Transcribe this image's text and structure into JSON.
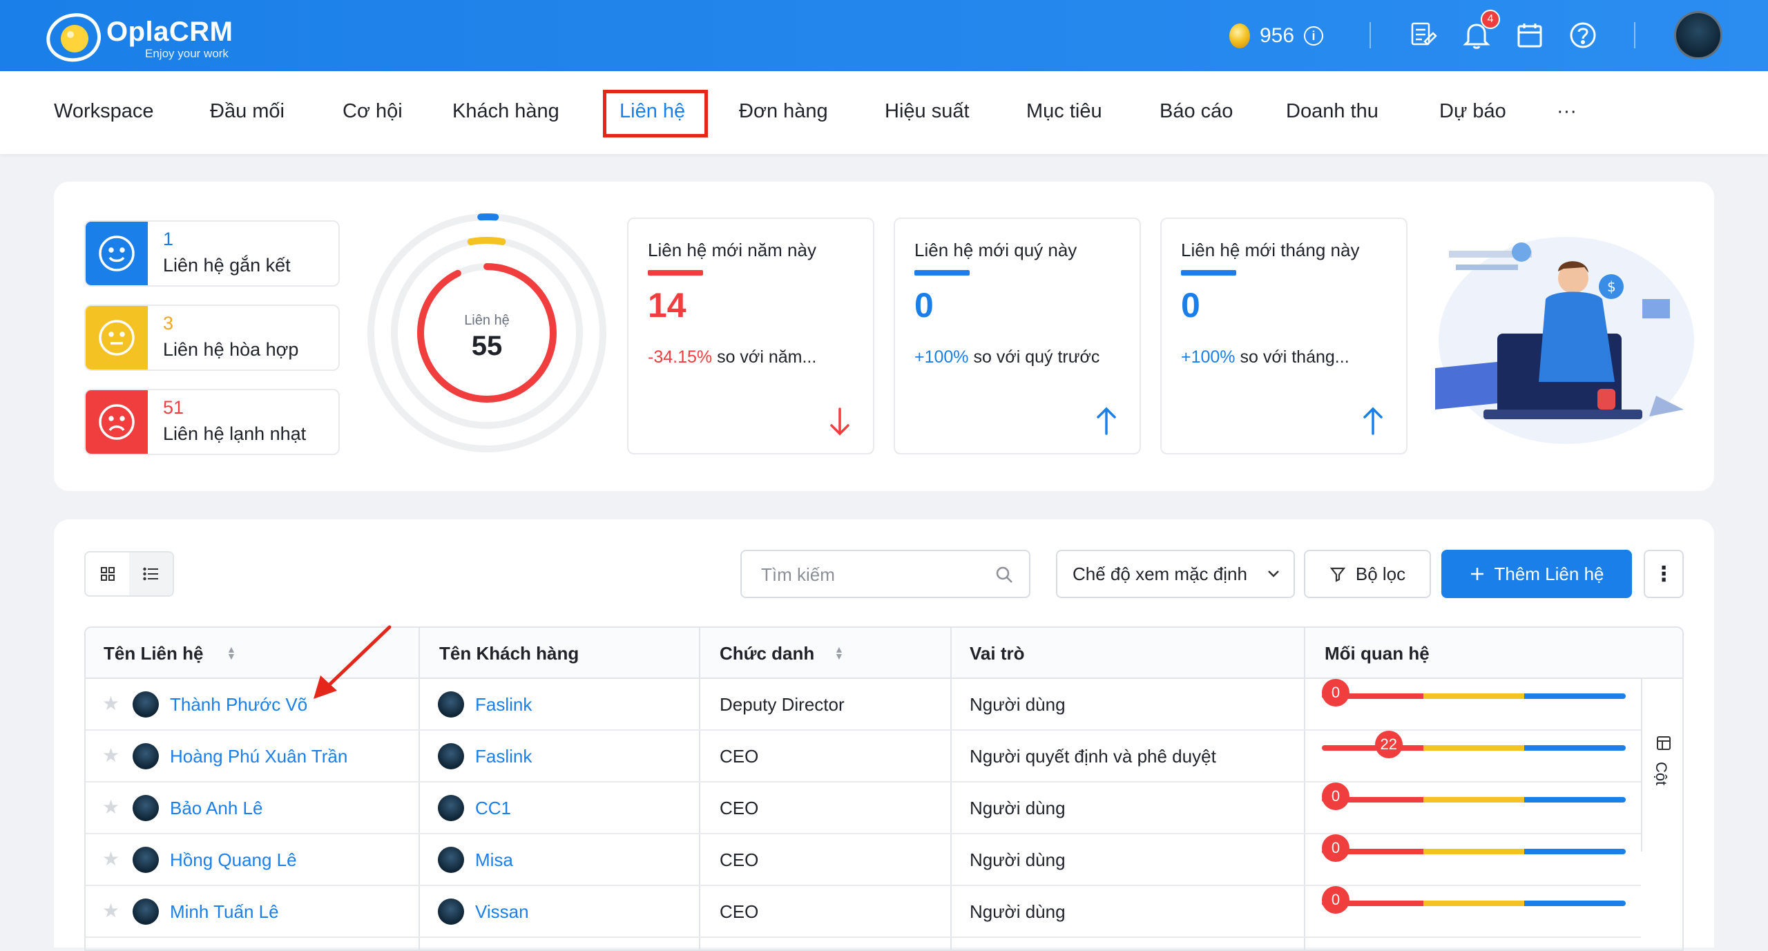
{
  "app": {
    "name": "OplaCRM",
    "tagline": "Enjoy your work"
  },
  "topbar": {
    "coins": "956",
    "notification_count": "4"
  },
  "nav": {
    "items": [
      "Workspace",
      "Đầu mối",
      "Cơ hội",
      "Khách hàng",
      "Liên hệ",
      "Đơn hàng",
      "Hiệu suất",
      "Mục tiêu",
      "Báo cáo",
      "Doanh thu",
      "Dự báo",
      "···"
    ],
    "active": "Liên hệ"
  },
  "moods": [
    {
      "count": "1",
      "label": "Liên hệ gắn kết",
      "color": "#1a7fe8"
    },
    {
      "count": "3",
      "label": "Liên hệ hòa hợp",
      "color": "#f5c224"
    },
    {
      "count": "51",
      "label": "Liên hệ lạnh nhạt",
      "color": "#f03e3e"
    }
  ],
  "ring": {
    "label": "Liên hệ",
    "total": "55"
  },
  "cards": [
    {
      "title": "Liên hệ mới năm này",
      "value": "14",
      "change": "-34.15%",
      "compare": " so với năm...",
      "color": "#f03e3e",
      "trend": "down"
    },
    {
      "title": "Liên hệ mới quý này",
      "value": "0",
      "change": "+100%",
      "compare": " so với quý trước",
      "color": "#1a7fe8",
      "trend": "up"
    },
    {
      "title": "Liên hệ mới tháng này",
      "value": "0",
      "change": "+100%",
      "compare": " so với tháng...",
      "color": "#1a7fe8",
      "trend": "up"
    }
  ],
  "toolbar": {
    "search_placeholder": "Tìm kiếm",
    "view_mode": "Chế độ xem mặc định",
    "filter_label": "Bộ lọc",
    "add_label": "Thêm Liên hệ",
    "more_label": "⋮"
  },
  "table": {
    "headers": [
      "Tên Liên hệ",
      "Tên Khách hàng",
      "Chức danh",
      "Vai trò",
      "Mối quan hệ"
    ],
    "columns_label": "Cột",
    "rows": [
      {
        "name": "Thành Phước Võ",
        "company": "Faslink",
        "title": "Deputy Director",
        "role": "Người dùng",
        "relation": "0",
        "relation_pct": 0
      },
      {
        "name": "Hoàng Phú Xuân Trần",
        "company": "Faslink",
        "title": "CEO",
        "role": "Người quyết định và phê duyệt",
        "relation": "22",
        "relation_pct": 22
      },
      {
        "name": "Bảo Anh Lê",
        "company": "CC1",
        "title": "CEO",
        "role": "Người dùng",
        "relation": "0",
        "relation_pct": 0
      },
      {
        "name": "Hồng Quang Lê",
        "company": "Misa",
        "title": "CEO",
        "role": "Người dùng",
        "relation": "0",
        "relation_pct": 0
      },
      {
        "name": "Minh Tuấn Lê",
        "company": "Vissan",
        "title": "CEO",
        "role": "Người dùng",
        "relation": "0",
        "relation_pct": 0
      }
    ]
  }
}
